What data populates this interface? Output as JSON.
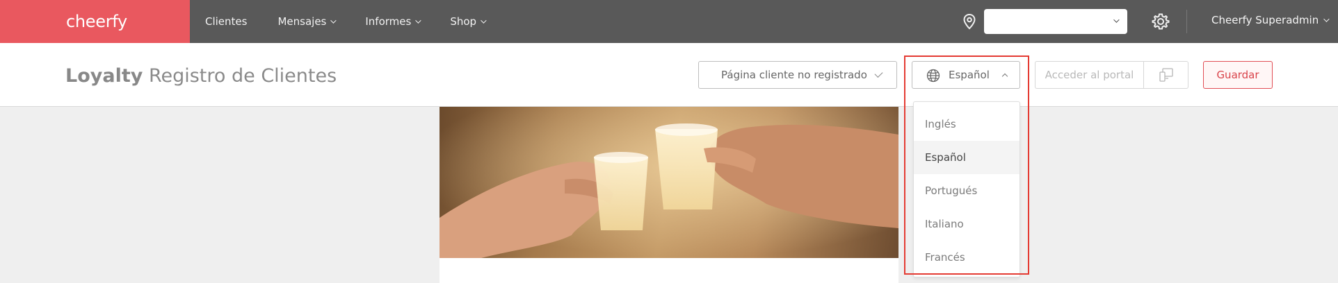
{
  "brand": {
    "logo_text": "cheerfy",
    "accent": "#e9585f",
    "nav_bg": "#595959"
  },
  "nav": {
    "items": [
      {
        "label": "Clientes",
        "has_menu": false
      },
      {
        "label": "Mensajes",
        "has_menu": true
      },
      {
        "label": "Informes",
        "has_menu": true
      },
      {
        "label": "Shop",
        "has_menu": true
      }
    ],
    "location_select": {
      "value": ""
    },
    "user_menu": {
      "label": "Cheerfy Superadmin"
    }
  },
  "header": {
    "title_bold": "Loyalty",
    "title_rest": "Registro de Clientes",
    "page_select": {
      "value": "Página cliente no registrado"
    },
    "language_select": {
      "value": "Español"
    },
    "portal_button": {
      "label": "Acceder al portal"
    },
    "save_button": {
      "label": "Guardar"
    }
  },
  "language_dropdown": {
    "options": [
      "Inglés",
      "Español",
      "Portugués",
      "Italiano",
      "Francés"
    ],
    "selected": "Español"
  },
  "icons": [
    "map-pin-icon",
    "chevron-down-icon",
    "gear-icon",
    "globe-icon",
    "chevron-up-icon",
    "check-icon",
    "devices-icon"
  ]
}
